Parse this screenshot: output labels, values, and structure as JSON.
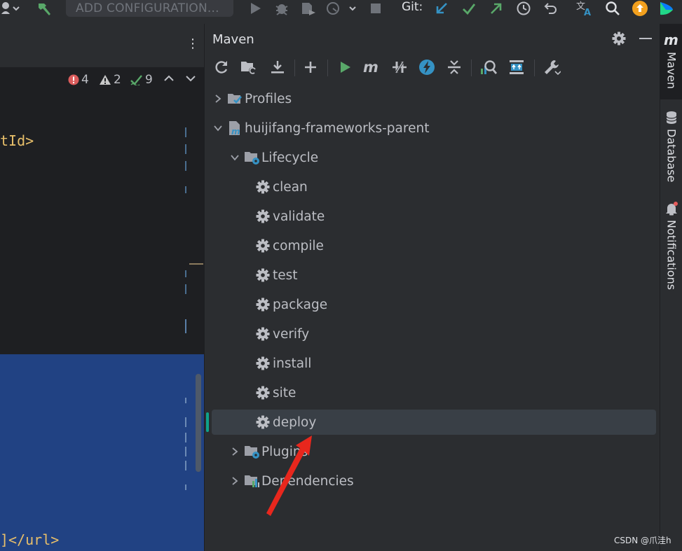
{
  "topbar": {
    "config_label": "ADD CONFIGURATION...",
    "git_label": "Git:",
    "icons": [
      "user-icon",
      "chevron-down-icon",
      "build-hammer-icon",
      "run-icon",
      "debug-icon",
      "coverage-icon",
      "profile-icon",
      "chevron-down-icon",
      "stop-icon",
      "git-update-icon",
      "git-commit-icon",
      "git-push-icon",
      "history-icon",
      "rollback-icon",
      "translate-icon",
      "search-icon",
      "update-icon",
      "app-logo-icon"
    ]
  },
  "editor": {
    "menu_glyph": "⋮",
    "inspections": {
      "errors": "4",
      "warnings": "2",
      "weak_warnings": "9"
    },
    "code_lines": [
      "tId>",
      "]</url>"
    ]
  },
  "maven": {
    "title": "Maven",
    "toolbar_icons": [
      "reload-icon",
      "generate-sources-icon",
      "download-icon",
      "add-icon",
      "run-maven-icon",
      "maven-goal-icon",
      "toggle-offline-icon",
      "skip-tests-icon",
      "collapse-all-icon",
      "analyze-dependencies-icon",
      "show-diagram-icon",
      "settings-wrench-icon"
    ],
    "tree": {
      "profiles": "Profiles",
      "project": "huijifang-frameworks-parent",
      "lifecycle": "Lifecycle",
      "goals": [
        "clean",
        "validate",
        "compile",
        "test",
        "package",
        "verify",
        "install",
        "site",
        "deploy"
      ],
      "plugins": "Plugins",
      "dependencies": "Dependencies"
    },
    "selected_goal": "deploy"
  },
  "strip": {
    "tabs": [
      {
        "label": "Maven"
      },
      {
        "label": "Database"
      },
      {
        "label": "Notifications"
      }
    ]
  },
  "colors": {
    "accent_green": "#59a869",
    "accent_blue": "#3592c4",
    "selection_bg": "#214283",
    "arrow_red": "#e8271d"
  },
  "watermark": "CSDN @爪洼h"
}
